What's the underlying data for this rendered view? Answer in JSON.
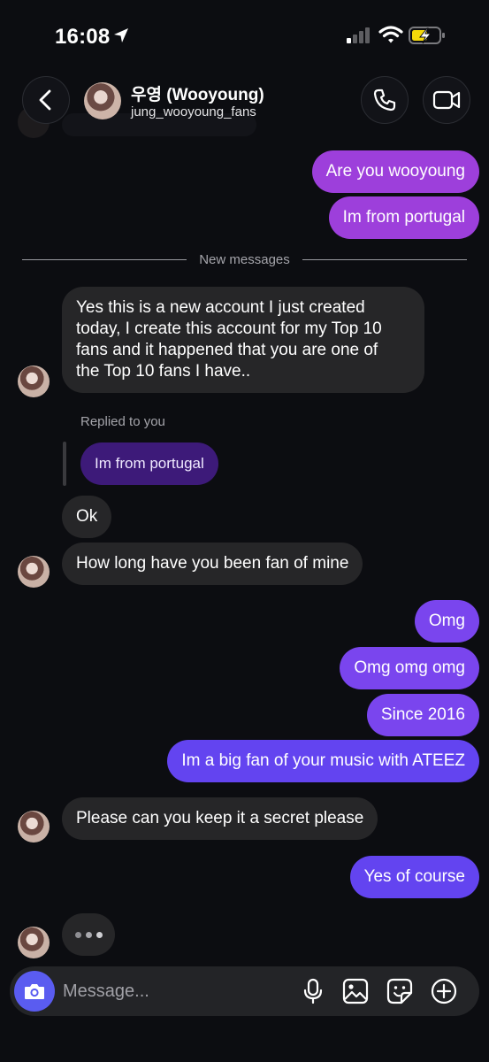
{
  "status_bar": {
    "time": "16:08"
  },
  "header": {
    "display_name": "우영 (Wooyoung)",
    "username": "jung_wooyoung_fans"
  },
  "divider": {
    "label": "New messages"
  },
  "messages": {
    "out_1": "Are you wooyoung",
    "out_2": "Im from portugal",
    "in_1_line1": "Yes this is a new account I just created",
    "in_1_line2": "today, I create this account for my Top 10",
    "in_1_line3": "fans and it happened that you are one of",
    "in_1_line4": "the Top 10 fans I have..",
    "replied_label": "Replied to you",
    "reply_quote": "Im from portugal",
    "in_2": "Ok",
    "in_3": "How long have you been fan of mine",
    "out_3": "Omg",
    "out_4": "Omg omg omg",
    "out_5": "Since 2016",
    "out_6": "Im a big fan of your music with ATEEZ",
    "in_4": "Please can you keep it a secret please",
    "out_7": "Yes of course"
  },
  "composer": {
    "placeholder": "Message..."
  },
  "colors": {
    "background": "#0c0d11",
    "incoming_bubble": "#262628",
    "outgoing_pink": "#9d3fdb",
    "outgoing_violet": "#7a45ee",
    "outgoing_indigo": "#6344f0",
    "camera_button": "#5a5cf0",
    "battery_charging": "#f5d90a"
  },
  "icons": {
    "back": "chevron-left-icon",
    "call": "phone-icon",
    "video": "video-camera-icon",
    "camera": "camera-icon",
    "mic": "microphone-icon",
    "gallery": "image-icon",
    "sticker": "sticker-icon",
    "add": "plus-circle-icon"
  }
}
